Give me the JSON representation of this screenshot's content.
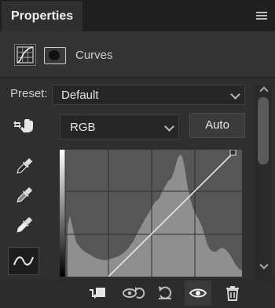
{
  "panel": {
    "title": "Properties",
    "adjustment_name": "Curves"
  },
  "preset": {
    "label": "Preset:",
    "value": "Default"
  },
  "channel": {
    "value": "RGB",
    "auto_label": "Auto"
  },
  "icons": {
    "menu": "panel-menu-icon",
    "curves": "curves-adjustment-icon",
    "mask": "layer-mask-icon",
    "targeted_adjust": "targeted-adjustment-hand-icon",
    "black_point": "black-point-eyedropper-icon",
    "gray_point": "gray-point-eyedropper-icon",
    "white_point": "white-point-eyedropper-icon",
    "edit_points": "edit-points-curve-icon",
    "clip_to_layer": "clip-to-layer-icon",
    "view_previous": "view-previous-state-icon",
    "reset": "reset-icon",
    "visibility": "visibility-eye-icon",
    "delete": "trash-icon"
  },
  "colors": {
    "panel_bg": "#2f2f2f",
    "graph_bg": "#555555",
    "histogram": "#8f8f8f",
    "curve_line": "#e6e6e6"
  }
}
